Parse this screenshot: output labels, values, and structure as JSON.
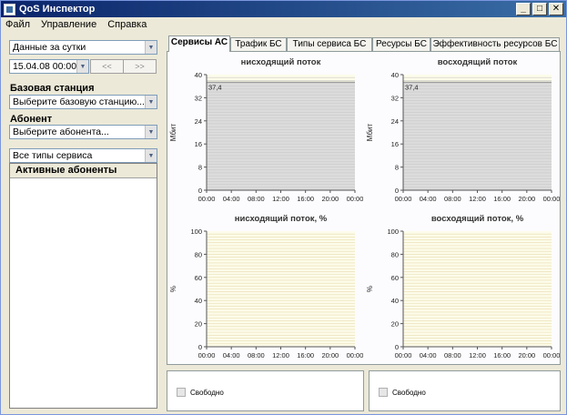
{
  "window": {
    "title": "QoS Инспектор",
    "minimize": "_",
    "maximize": "□",
    "close": "✕"
  },
  "menu": [
    "Файл",
    "Управление",
    "Справка"
  ],
  "left": {
    "period": "Данные за сутки",
    "date": "15.04.08 00:00",
    "prev": "<<",
    "next": ">>",
    "base_station_label": "Базовая станция",
    "base_station_value": "Выберите базовую станцию...",
    "subscriber_label": "Абонент",
    "subscriber_value": "Выберите абонента...",
    "service_types": "Все типы сервиса",
    "active_subscribers": "Активные абоненты"
  },
  "tabs": [
    "Сервисы АС",
    "Трафик БС",
    "Типы сервиса БС",
    "Ресурсы БС",
    "Эффективность ресурсов БС"
  ],
  "colors": {
    "plot_bg": "#fdfcea",
    "gridline": "#e8dcb0",
    "fill": "#dcdcdc",
    "threshold": "#8a8a8a"
  },
  "chart_data": [
    {
      "type": "area",
      "title": "нисходящий поток",
      "ylabel": "Мбит",
      "yticks": [
        0,
        8,
        16,
        24,
        32,
        40
      ],
      "ylim": [
        0,
        40
      ],
      "xticks": [
        "00:00",
        "04:00",
        "08:00",
        "12:00",
        "16:00",
        "20:00",
        "00:00"
      ],
      "threshold": 37.4,
      "threshold_label": "37,4"
    },
    {
      "type": "area",
      "title": "восходящий поток",
      "ylabel": "Мбит",
      "yticks": [
        0,
        8,
        16,
        24,
        32,
        40
      ],
      "ylim": [
        0,
        40
      ],
      "xticks": [
        "00:00",
        "04:00",
        "08:00",
        "12:00",
        "16:00",
        "20:00",
        "00:00"
      ],
      "threshold": 37.4,
      "threshold_label": "37,4"
    },
    {
      "type": "area",
      "title": "нисходящий поток, %",
      "ylabel": "%",
      "yticks": [
        0,
        20,
        40,
        60,
        80,
        100
      ],
      "ylim": [
        0,
        100
      ],
      "xticks": [
        "00:00",
        "04:00",
        "08:00",
        "12:00",
        "16:00",
        "20:00",
        "00:00"
      ]
    },
    {
      "type": "area",
      "title": "восходящий поток, %",
      "ylabel": "%",
      "yticks": [
        0,
        20,
        40,
        60,
        80,
        100
      ],
      "ylim": [
        0,
        100
      ],
      "xticks": [
        "00:00",
        "04:00",
        "08:00",
        "12:00",
        "16:00",
        "20:00",
        "00:00"
      ]
    }
  ],
  "legends": [
    "Свободно",
    "Свободно"
  ]
}
